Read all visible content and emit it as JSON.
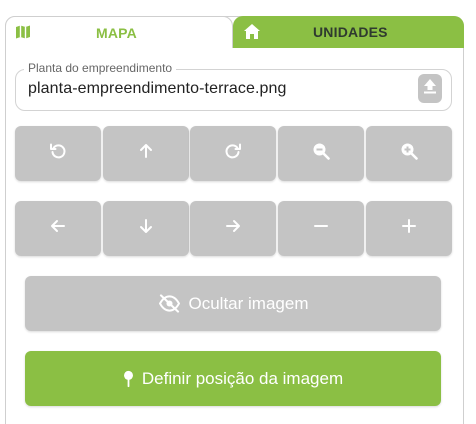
{
  "tabs": {
    "map": {
      "label": "MAPA",
      "icon": "map-icon",
      "active": true
    },
    "units": {
      "label": "UNIDADES",
      "icon": "home-icon",
      "active": false
    }
  },
  "file_field": {
    "label": "Planta do empreendimento",
    "value": "planta-empreendimento-terrace.png",
    "upload_icon": "upload-icon"
  },
  "controls": {
    "row1": [
      "rotate-left-icon",
      "arrow-up-icon",
      "rotate-right-icon",
      "zoom-out-icon",
      "zoom-in-icon"
    ],
    "row2": [
      "arrow-left-icon",
      "arrow-down-icon",
      "arrow-right-icon",
      "minus-icon",
      "plus-icon"
    ]
  },
  "buttons": {
    "hide_image": {
      "label": "Ocultar imagem",
      "icon": "eye-off-icon"
    },
    "set_position": {
      "label": "Definir posição da imagem",
      "icon": "map-pin-icon"
    }
  },
  "colors": {
    "accent": "#8bbf44",
    "button_gray": "#c4c4c4",
    "tab_dark_text": "#2f3a2f"
  }
}
